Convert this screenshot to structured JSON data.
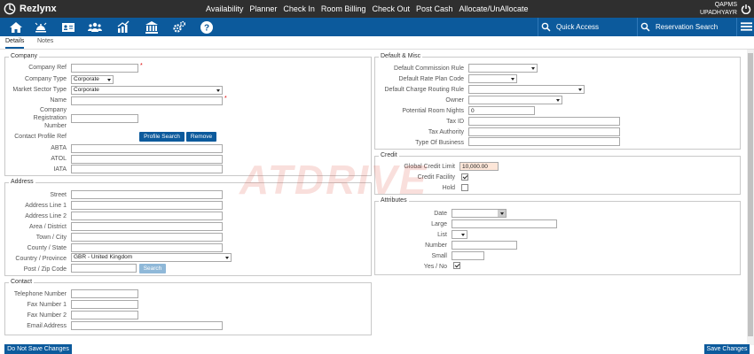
{
  "app": {
    "name": "Rezlynx"
  },
  "topnav": [
    "Availability",
    "Planner",
    "Check In",
    "Room Billing",
    "Check Out",
    "Post Cash",
    "Allocate/UnAllocate"
  ],
  "user": {
    "line1": "QAPMS",
    "line2": "UPADHYAYR"
  },
  "iconbar": {
    "quick_access": "Quick Access",
    "reservation_search": "Reservation Search"
  },
  "tabs": [
    "Details",
    "Notes"
  ],
  "company": {
    "title": "Company",
    "company_ref_label": "Company Ref",
    "company_ref_value": "",
    "company_type_label": "Company Type",
    "company_type_value": "Corporate",
    "market_sector_label": "Market Sector Type",
    "market_sector_value": "Corporate",
    "name_label": "Name",
    "name_value": "",
    "reg_label_1": "Company",
    "reg_label_2": "Registration",
    "reg_label_3": "Number",
    "reg_value": "",
    "contact_profile_label": "Contact Profile Ref",
    "profile_search": "Profile Search",
    "remove": "Remove",
    "abta_label": "ABTA",
    "atol_label": "ATOL",
    "iata_label": "IATA"
  },
  "address": {
    "title": "Address",
    "street": "Street",
    "line1": "Address Line 1",
    "line2": "Address Line 2",
    "area": "Area / District",
    "town": "Town / City",
    "county": "County / State",
    "country_label": "Country / Province",
    "country_value": "GBR - United Kingdom",
    "post_label": "Post / Zip Code",
    "search": "Search"
  },
  "contact": {
    "title": "Contact",
    "telephone": "Telephone Number",
    "fax1": "Fax Number 1",
    "fax2": "Fax Number 2",
    "email": "Email Address"
  },
  "default_misc": {
    "title": "Default & Misc",
    "commission_rule": "Default Commission Rule",
    "rate_plan_code": "Default Rate Plan Code",
    "charge_routing": "Default Charge Routing Rule",
    "owner": "Owner",
    "potential_room_nights": "Potential Room Nights",
    "potential_room_nights_value": "0",
    "tax_id": "Tax ID",
    "tax_authority": "Tax Authority",
    "type_of_business": "Type Of Business"
  },
  "credit": {
    "title": "Credit",
    "global_limit_label": "Global Credit Limit",
    "global_limit_value": "10,000.00",
    "facility_label": "Credit Facility",
    "facility_checked": true,
    "hold_label": "Hold",
    "hold_checked": false
  },
  "attributes": {
    "title": "Attributes",
    "date": "Date",
    "large": "Large",
    "list": "List",
    "number": "Number",
    "small": "Small",
    "yes_no": "Yes / No",
    "yes_no_checked": true
  },
  "footer": {
    "do_not_save": "Do Not Save Changes",
    "save": "Save Changes"
  },
  "watermark": "ATDRIVE",
  "colors": {
    "topbar": "#2f2f2f",
    "iconbar": "#0c5a9c",
    "button": "#0c5a9c",
    "credit_limit_bg": "#fde6d8"
  }
}
